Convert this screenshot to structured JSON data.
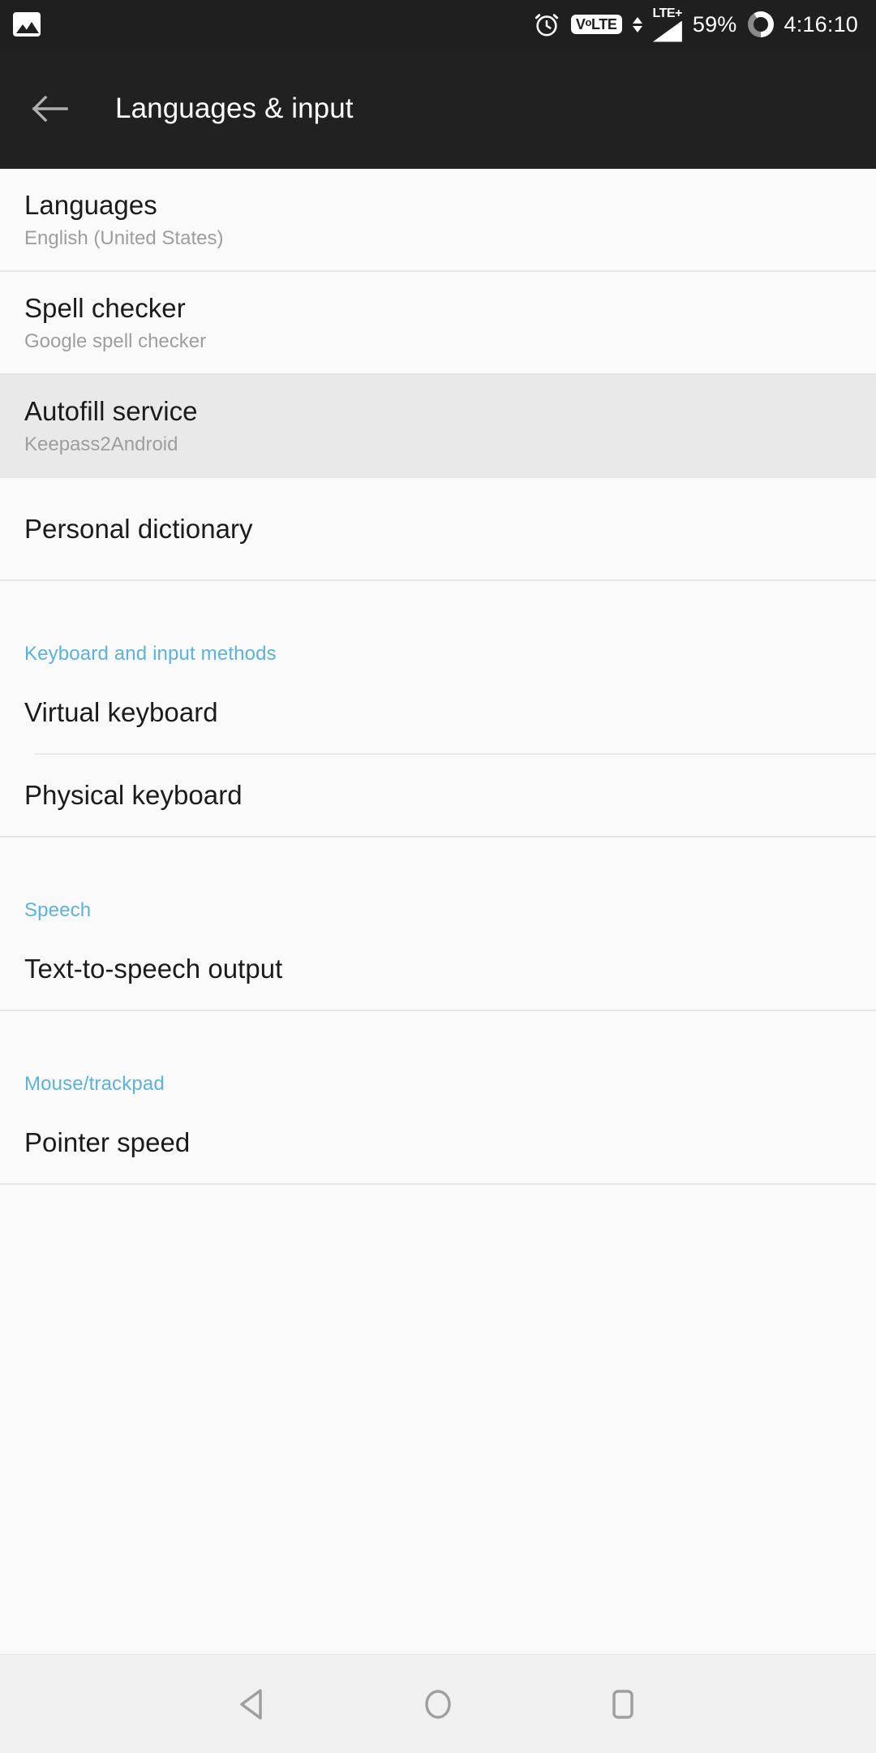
{
  "status_bar": {
    "notification_icon": "photo-icon",
    "alarm_icon": "alarm-icon",
    "volte_label": "VoLTE",
    "data_arrows_icon": "data-transfer-arrows-icon",
    "network_label": "LTE+",
    "signal_icon": "signal-bars-icon",
    "battery_percent": "59%",
    "battery_icon": "battery-ring-icon",
    "clock": "4:16:10"
  },
  "app_bar": {
    "back_icon": "arrow-left-icon",
    "title": "Languages & input"
  },
  "theme": {
    "status_bar_bg": "#1f1f1f",
    "app_bar_bg": "#212121",
    "page_bg": "#fafafa",
    "selected_row_bg": "#e9e9e9",
    "section_header_color": "#5ab2dd",
    "primary_text": "#1b1b1b",
    "secondary_text": "#9e9e9e",
    "divider": "#e6e6e7",
    "nav_bar_bg": "#f0f0f0",
    "nav_icon_color": "#9e9e9e"
  },
  "settings": {
    "rows": [
      {
        "title": "Languages",
        "subtitle": "English (United States)",
        "selected": false
      },
      {
        "title": "Spell checker",
        "subtitle": "Google spell checker",
        "selected": false
      },
      {
        "title": "Autofill service",
        "subtitle": "Keepass2Android",
        "selected": true
      },
      {
        "title": "Personal dictionary",
        "subtitle": "",
        "selected": false
      }
    ],
    "sections": [
      {
        "header": "Keyboard and input methods",
        "items": [
          {
            "title": "Virtual keyboard"
          },
          {
            "title": "Physical keyboard"
          }
        ]
      },
      {
        "header": "Speech",
        "items": [
          {
            "title": "Text-to-speech output"
          }
        ]
      },
      {
        "header": "Mouse/trackpad",
        "items": [
          {
            "title": "Pointer speed"
          }
        ]
      }
    ]
  },
  "nav_bar": {
    "back_icon": "nav-back-triangle-icon",
    "home_icon": "nav-home-circle-icon",
    "recents_icon": "nav-recents-square-icon"
  }
}
